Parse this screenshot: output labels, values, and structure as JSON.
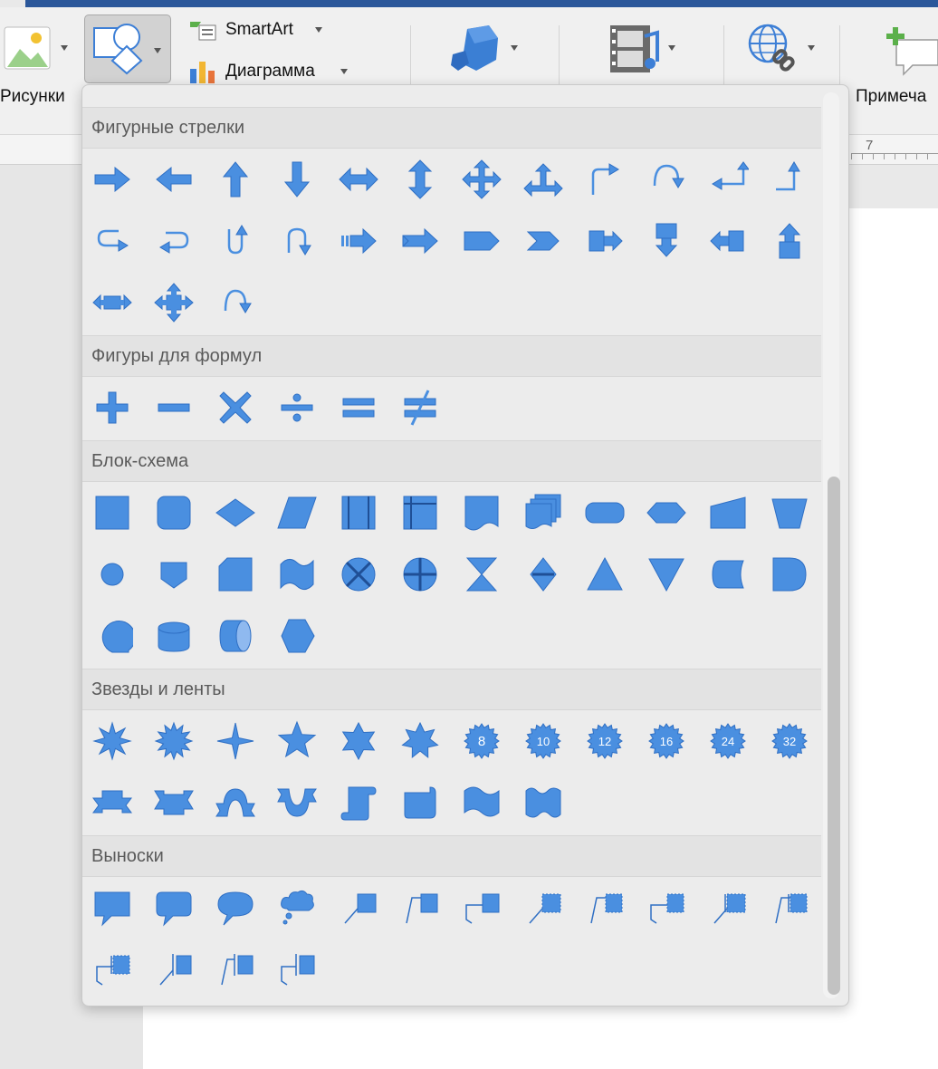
{
  "ribbon": {
    "pictures_label": "Рисунки",
    "smartart_label": "SmartArt",
    "chart_label": "Диаграмма",
    "comment_label": "Примеча",
    "ruler_mark": "7"
  },
  "icons": {
    "pictures": "picture-icon",
    "shapes": "shapes-icon",
    "smartart": "smartart-icon",
    "chart": "chart-icon",
    "3d_models": "3d-model-icon",
    "media": "media-icon",
    "link": "link-icon",
    "comment": "comment-icon"
  },
  "colors": {
    "shape_fill": "#4a8fe0",
    "shape_stroke": "#2f6fc4",
    "header_text": "#5a5a5a"
  },
  "sections": [
    {
      "title": "Фигурные стрелки",
      "count": 27
    },
    {
      "title": "Фигуры для формул",
      "count": 6
    },
    {
      "title": "Блок-схема",
      "count": 28
    },
    {
      "title": "Звезды и ленты",
      "count": 20
    },
    {
      "title": "Выноски",
      "count": 16
    }
  ]
}
